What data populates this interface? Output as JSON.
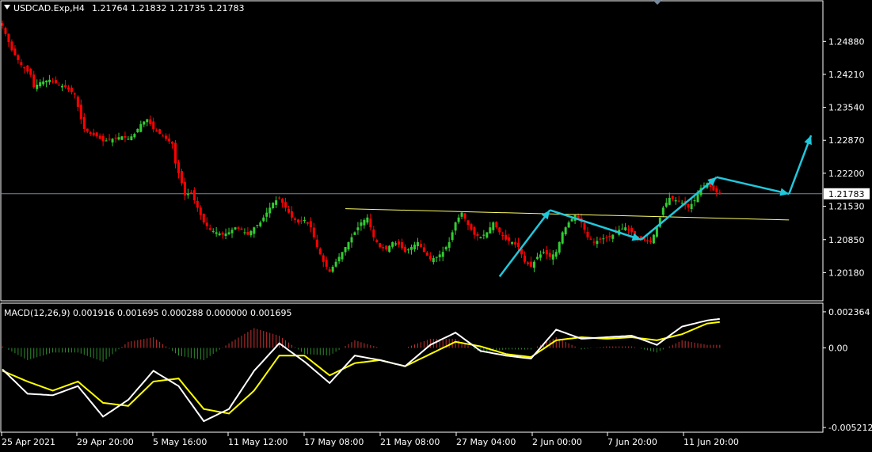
{
  "header": {
    "symbol": "USDCAD.Exp,H4",
    "ohlc": "1.21764 1.21832 1.21735 1.21783"
  },
  "macd_header": {
    "label": "MACD(12,26,9) 0.001916 0.001695 0.000288 0.000000 0.001695"
  },
  "colors": {
    "background": "#000000",
    "frame": "#ffffff",
    "bull": "#32cd32",
    "bear": "#ff0000",
    "trendline": "#ffff66",
    "arrows": "#20c8dc",
    "price_line": "#778899",
    "macd_fast": "#ffffff",
    "macd_signal": "#ffff00",
    "hist_up": "#c83232",
    "hist_down": "#2d8c2d"
  },
  "chart_data": [
    {
      "type": "candlestick",
      "title": "USDCAD.Exp,H4",
      "yticks": [
        "1.24880",
        "1.24210",
        "1.23540",
        "1.22870",
        "1.22200",
        "1.21530",
        "1.20850",
        "1.20180"
      ],
      "ylim": [
        1.198,
        1.254
      ],
      "current_price": "1.21783",
      "xticks": [
        "25 Apr 2021",
        "29 Apr 20:00",
        "5 May 16:00",
        "11 May 12:00",
        "17 May 08:00",
        "21 May 08:00",
        "27 May 04:00",
        "2 Jun 00:00",
        "7 Jun 20:00",
        "11 Jun 20:00"
      ],
      "series": [
        {
          "values": [
            [
              0,
              1.252
            ],
            [
              3,
              1.247
            ],
            [
              6,
              1.244
            ],
            [
              9,
              1.242
            ],
            [
              10,
              1.2395
            ],
            [
              12,
              1.2405
            ],
            [
              15,
              1.241
            ],
            [
              18,
              1.24
            ],
            [
              20,
              1.2395
            ],
            [
              23,
              1.238
            ],
            [
              25,
              1.233
            ],
            [
              26,
              1.231
            ],
            [
              28,
              1.23
            ],
            [
              30,
              1.2295
            ],
            [
              32,
              1.2285
            ],
            [
              35,
              1.229
            ],
            [
              38,
              1.2295
            ],
            [
              40,
              1.229
            ],
            [
              42,
              1.23
            ],
            [
              44,
              1.232
            ],
            [
              46,
              1.233
            ],
            [
              48,
              1.231
            ],
            [
              50,
              1.23
            ],
            [
              52,
              1.229
            ],
            [
              54,
              1.228
            ],
            [
              55,
              1.224
            ],
            [
              57,
              1.22
            ],
            [
              58,
              1.2175
            ],
            [
              60,
              1.218
            ],
            [
              62,
              1.215
            ],
            [
              64,
              1.212
            ],
            [
              66,
              1.2105
            ],
            [
              68,
              1.21
            ],
            [
              70,
              1.2095
            ],
            [
              72,
              1.21
            ],
            [
              74,
              1.211
            ],
            [
              76,
              1.2105
            ],
            [
              78,
              1.2095
            ],
            [
              80,
              1.211
            ],
            [
              82,
              1.212
            ],
            [
              84,
              1.214
            ],
            [
              86,
              1.216
            ],
            [
              88,
              1.217
            ],
            [
              90,
              1.215
            ],
            [
              92,
              1.213
            ],
            [
              94,
              1.212
            ],
            [
              96,
              1.2125
            ],
            [
              98,
              1.211
            ],
            [
              100,
              1.207
            ],
            [
              102,
              1.204
            ],
            [
              104,
              1.202
            ],
            [
              106,
              1.204
            ],
            [
              108,
              1.206
            ],
            [
              110,
              1.208
            ],
            [
              112,
              1.21
            ],
            [
              114,
              1.212
            ],
            [
              116,
              1.213
            ],
            [
              118,
              1.209
            ],
            [
              120,
              1.207
            ],
            [
              122,
              1.2065
            ],
            [
              124,
              1.208
            ],
            [
              126,
              1.2075
            ],
            [
              128,
              1.206
            ],
            [
              130,
              1.207
            ],
            [
              132,
              1.208
            ],
            [
              134,
              1.206
            ],
            [
              136,
              1.2045
            ],
            [
              138,
              1.205
            ],
            [
              140,
              1.206
            ],
            [
              142,
              1.208
            ],
            [
              144,
              1.212
            ],
            [
              146,
              1.214
            ],
            [
              148,
              1.2115
            ],
            [
              150,
              1.2095
            ],
            [
              152,
              1.209
            ],
            [
              154,
              1.21
            ],
            [
              156,
              1.212
            ],
            [
              158,
              1.21
            ],
            [
              160,
              1.2085
            ],
            [
              162,
              1.208
            ],
            [
              164,
              1.207
            ],
            [
              166,
              1.204
            ],
            [
              168,
              1.203
            ],
            [
              170,
              1.205
            ],
            [
              172,
              1.206
            ],
            [
              174,
              1.205
            ],
            [
              176,
              1.206
            ],
            [
              178,
              1.21
            ],
            [
              180,
              1.212
            ],
            [
              182,
              1.2135
            ],
            [
              184,
              1.212
            ],
            [
              186,
              1.209
            ],
            [
              188,
              1.208
            ],
            [
              190,
              1.2085
            ],
            [
              192,
              1.209
            ],
            [
              194,
              1.2095
            ],
            [
              196,
              1.2105
            ],
            [
              198,
              1.211
            ],
            [
              200,
              1.21
            ],
            [
              202,
              1.209
            ],
            [
              204,
              1.2085
            ],
            [
              206,
              1.208
            ],
            [
              208,
              1.211
            ],
            [
              210,
              1.215
            ],
            [
              212,
              1.217
            ],
            [
              214,
              1.2165
            ],
            [
              216,
              1.216
            ],
            [
              218,
              1.215
            ],
            [
              220,
              1.2165
            ],
            [
              222,
              1.219
            ],
            [
              224,
              1.22
            ],
            [
              226,
              1.2185
            ],
            [
              228,
              1.2178
            ]
          ]
        }
      ],
      "annotations": {
        "trendline": [
          [
            109,
            1.2148
          ],
          [
            250,
            1.2125
          ]
        ],
        "arrows": [
          [
            [
              158,
              1.201
            ],
            [
              174,
              1.2145
            ]
          ],
          [
            [
              174,
              1.2145
            ],
            [
              203,
              1.2085
            ]
          ],
          [
            [
              203,
              1.2085
            ],
            [
              227,
              1.2212
            ]
          ],
          [
            [
              227,
              1.2212
            ],
            [
              250,
              1.2178
            ]
          ],
          [
            [
              250,
              1.2178
            ],
            [
              257,
              1.2297
            ]
          ]
        ]
      }
    },
    {
      "type": "line",
      "title": "MACD(12,26,9)",
      "yticks": [
        "0.002364",
        "0.00",
        "-0.005212"
      ],
      "ylim": [
        -0.00521,
        0.00236
      ],
      "series": [
        {
          "name": "MACD",
          "values": [
            [
              0,
              -0.0014
            ],
            [
              8,
              -0.003
            ],
            [
              16,
              -0.0031
            ],
            [
              24,
              -0.0025
            ],
            [
              32,
              -0.0045
            ],
            [
              40,
              -0.0034
            ],
            [
              48,
              -0.0015
            ],
            [
              56,
              -0.0025
            ],
            [
              64,
              -0.0048
            ],
            [
              72,
              -0.004
            ],
            [
              80,
              -0.0015
            ],
            [
              88,
              0.0003
            ],
            [
              96,
              -0.0009
            ],
            [
              104,
              -0.0023
            ],
            [
              112,
              -0.0005
            ],
            [
              120,
              -0.0008
            ],
            [
              128,
              -0.0012
            ],
            [
              136,
              0.0002
            ],
            [
              144,
              0.001
            ],
            [
              152,
              -0.0002
            ],
            [
              160,
              -0.0005
            ],
            [
              168,
              -0.0007
            ],
            [
              176,
              0.0012
            ],
            [
              184,
              0.0006
            ],
            [
              192,
              0.0007
            ],
            [
              200,
              0.0008
            ],
            [
              208,
              0.0002
            ],
            [
              216,
              0.0014
            ],
            [
              224,
              0.0018
            ],
            [
              228,
              0.0019
            ]
          ]
        },
        {
          "name": "Signal",
          "values": [
            [
              0,
              -0.0015
            ],
            [
              8,
              -0.0022
            ],
            [
              16,
              -0.0028
            ],
            [
              24,
              -0.0022
            ],
            [
              32,
              -0.0036
            ],
            [
              40,
              -0.0038
            ],
            [
              48,
              -0.0022
            ],
            [
              56,
              -0.002
            ],
            [
              64,
              -0.004
            ],
            [
              72,
              -0.0043
            ],
            [
              80,
              -0.0028
            ],
            [
              88,
              -0.0005
            ],
            [
              96,
              -0.0005
            ],
            [
              104,
              -0.0018
            ],
            [
              112,
              -0.001
            ],
            [
              120,
              -0.0008
            ],
            [
              128,
              -0.0012
            ],
            [
              136,
              -0.0004
            ],
            [
              144,
              0.0004
            ],
            [
              152,
              0.0001
            ],
            [
              160,
              -0.0004
            ],
            [
              168,
              -0.0006
            ],
            [
              176,
              0.0005
            ],
            [
              184,
              0.0007
            ],
            [
              192,
              0.0006
            ],
            [
              200,
              0.0007
            ],
            [
              208,
              0.0005
            ],
            [
              216,
              0.0009
            ],
            [
              224,
              0.0016
            ],
            [
              228,
              0.0017
            ]
          ]
        },
        {
          "name": "Histogram",
          "values": [
            [
              0,
              0.0001
            ],
            [
              8,
              -0.0008
            ],
            [
              16,
              -0.0003
            ],
            [
              24,
              -0.0003
            ],
            [
              32,
              -0.0009
            ],
            [
              40,
              0.0004
            ],
            [
              48,
              0.0007
            ],
            [
              56,
              -0.0005
            ],
            [
              64,
              -0.0008
            ],
            [
              72,
              0.0003
            ],
            [
              80,
              0.0013
            ],
            [
              88,
              0.0008
            ],
            [
              96,
              -0.0004
            ],
            [
              104,
              -0.0005
            ],
            [
              112,
              0.0005
            ],
            [
              120,
              0.0
            ],
            [
              128,
              0.0
            ],
            [
              136,
              0.0006
            ],
            [
              144,
              0.0006
            ],
            [
              152,
              -0.0003
            ],
            [
              160,
              -0.0001
            ],
            [
              168,
              -0.0001
            ],
            [
              176,
              0.0007
            ],
            [
              184,
              -0.0001
            ],
            [
              192,
              0.0001
            ],
            [
              200,
              0.0001
            ],
            [
              208,
              -0.0003
            ],
            [
              216,
              0.0005
            ],
            [
              224,
              0.0002
            ],
            [
              228,
              0.0002
            ]
          ]
        }
      ]
    }
  ]
}
